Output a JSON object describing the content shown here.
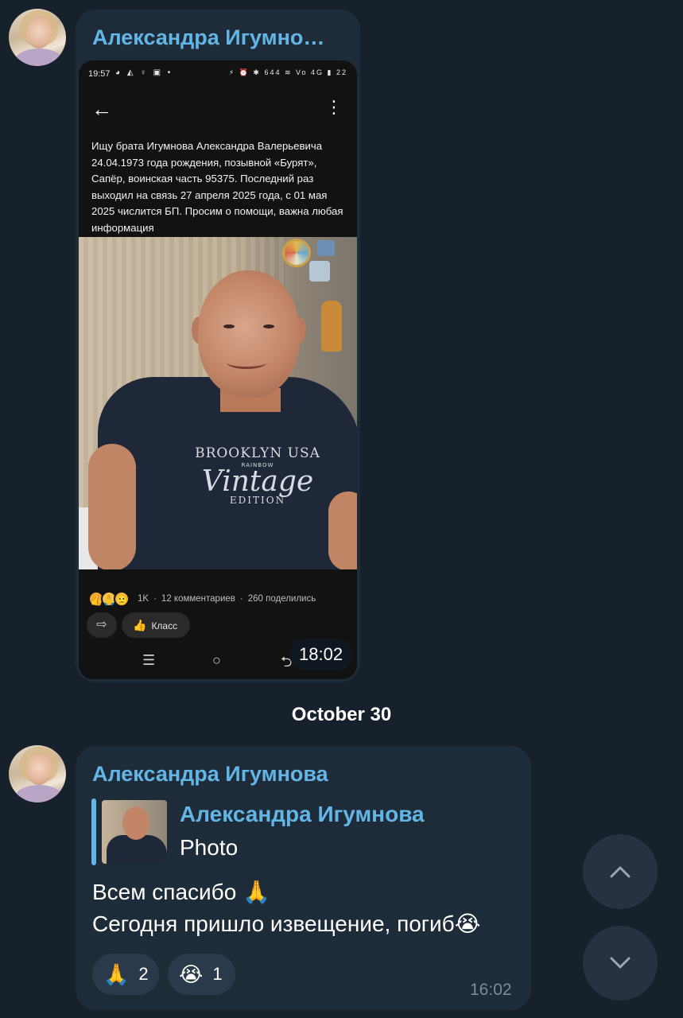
{
  "messages": [
    {
      "sender": "Александра Игумно…",
      "post_screenshot": {
        "status_time": "19:57",
        "status_icons_left": "◕ ◭ ♀ ▣ •",
        "status_icons_right": "⚡ ⏰ ✱ 644 ≋ Vo 4G ▮ 22",
        "back_icon": "←",
        "menu_icon": "⋮",
        "post_text": "Ищу брата Игумнова Александра Валерьевича 24.04.1973 года рождения, позывной «Бурят», Сапёр,  воинская часть 95375. Последний раз выходил на связь 27 апреля 2025 года, с 01 мая 2025 числится БП. Просим о помощи, важна любая информация",
        "shirt_print": {
          "line1": "BROOKLYN USA",
          "line2": "RAINBOW",
          "line3": "Vintage",
          "line4": "EDITION"
        },
        "reaction_emojis": [
          "👍",
          "🙏",
          "🙁"
        ],
        "reactions_count": "1K",
        "comments": "12 комментариев",
        "shares": "260 поделились",
        "share_icon": "⇨",
        "klass_label": "Класс",
        "klass_icon": "👍",
        "nav_icons": [
          "☰",
          "○",
          "⮌"
        ]
      },
      "time": "18:02"
    },
    {
      "sender": "Александра Игумнова",
      "reply": {
        "name": "Александра Игумнова",
        "type": "Photo"
      },
      "text_line1": "Всем спасибо 🙏",
      "text_line2": "Сегодня пришло извещение, погиб😭",
      "reactions": [
        {
          "emoji": "🙏",
          "count": "2"
        },
        {
          "emoji": "😭",
          "count": "1"
        }
      ],
      "time": "16:02"
    }
  ],
  "date_separator": "October 30",
  "colors": {
    "background": "#17212b",
    "bubble": "#1e2c3a",
    "accent": "#63b5e6",
    "chip": "#2b3a4b"
  }
}
